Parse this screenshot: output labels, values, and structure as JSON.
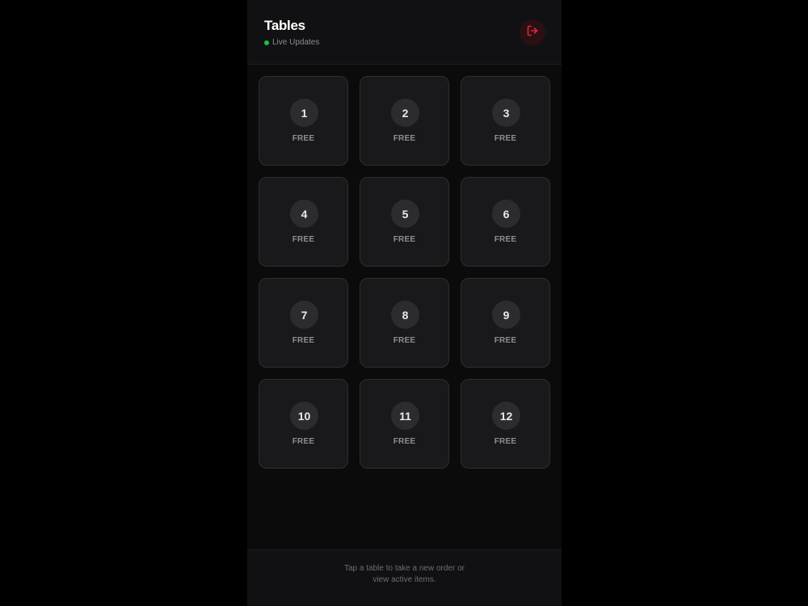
{
  "header": {
    "title": "Tables",
    "status_text": "Live Updates",
    "logout_icon": "logout-icon"
  },
  "tables": [
    {
      "number": "1",
      "status": "FREE"
    },
    {
      "number": "2",
      "status": "FREE"
    },
    {
      "number": "3",
      "status": "FREE"
    },
    {
      "number": "4",
      "status": "FREE"
    },
    {
      "number": "5",
      "status": "FREE"
    },
    {
      "number": "6",
      "status": "FREE"
    },
    {
      "number": "7",
      "status": "FREE"
    },
    {
      "number": "8",
      "status": "FREE"
    },
    {
      "number": "9",
      "status": "FREE"
    },
    {
      "number": "10",
      "status": "FREE"
    },
    {
      "number": "11",
      "status": "FREE"
    },
    {
      "number": "12",
      "status": "FREE"
    }
  ],
  "footer": {
    "hint": "Tap a table to take a new order or view active items."
  },
  "colors": {
    "live": "#16c53b",
    "logout": "#e0283a",
    "background": "#0b0b0c"
  }
}
